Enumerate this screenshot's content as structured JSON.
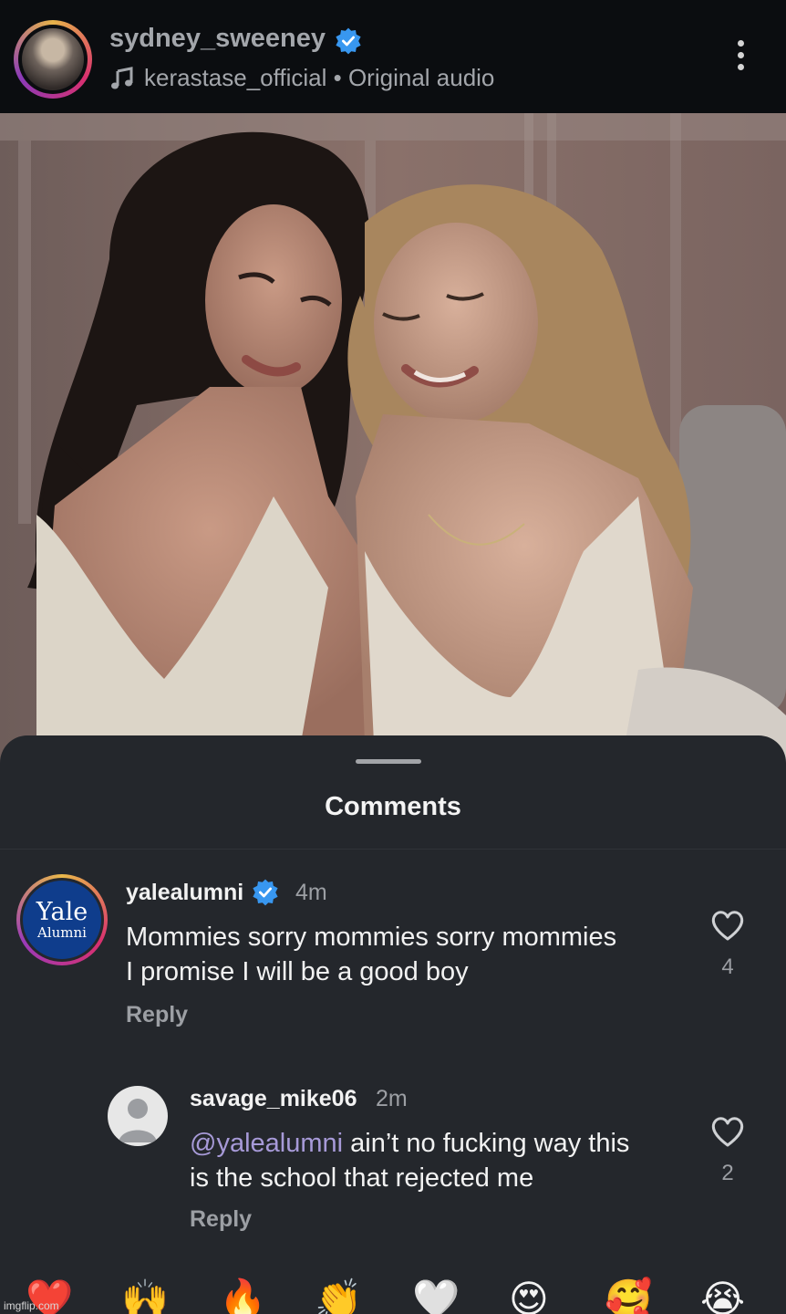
{
  "header": {
    "username": "sydney_sweeney",
    "audio": "kerastase_official • Original audio"
  },
  "sheet": {
    "title": "Comments"
  },
  "comments": [
    {
      "username": "yalealumni",
      "time": "4m",
      "text_line1": "Mommies sorry mommies sorry mommies",
      "text_line2": "I promise I will be a good boy",
      "reply_label": "Reply",
      "likes": "4",
      "avatar_logo_text": "Yale",
      "avatar_logo_sub": "Alumni"
    },
    {
      "username": "savage_mike06",
      "time": "2m",
      "mention": "@yalealumni",
      "text_line1_rest": " ain’t no fucking way this",
      "text_line2": "is the school that rejected me",
      "reply_label": "Reply",
      "likes": "2"
    }
  ],
  "emoji_bar": [
    "❤️",
    "🙌",
    "🔥",
    "👏",
    "🤍",
    "😍",
    "🥰",
    "😭"
  ],
  "watermark": "imgflip.com",
  "colors": {
    "background": "#0b0d10",
    "sheet": "#24272c",
    "verified": "#3897f0",
    "mention": "#a79ad8"
  }
}
